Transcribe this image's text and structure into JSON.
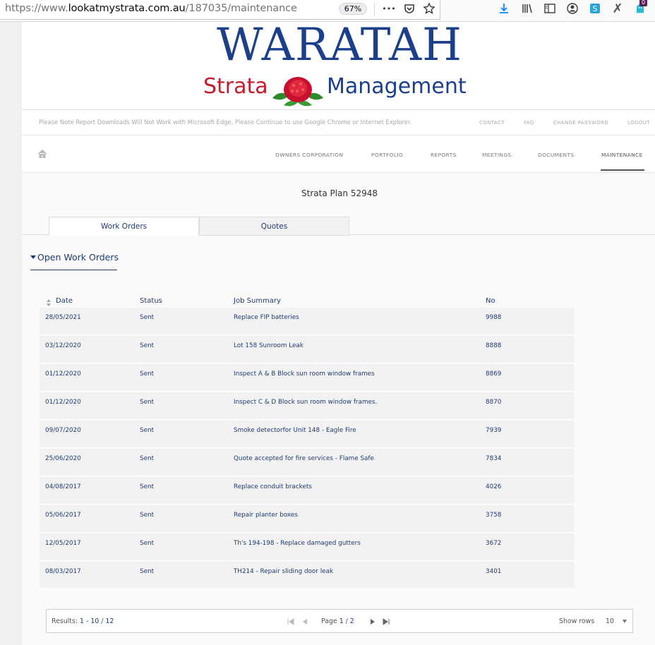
{
  "browser": {
    "url_prefix": "https://www.",
    "url_host": "lookatmystrata.com.au",
    "url_path": "/187035/maintenance",
    "zoom": "67%",
    "more_label": "•••",
    "notification_count": "0"
  },
  "logo": {
    "top": "WARATAH",
    "left": "Strata",
    "right": "Management"
  },
  "topbar": {
    "notice": "Please Note Report Downloads Will Not Work with Microsoft Edge, Please Continue to use Google Chrome or Internet Explorer.",
    "links": [
      "CONTACT",
      "FAQ",
      "CHANGE PASSWORD",
      "LOGOUT"
    ]
  },
  "nav": {
    "items": [
      "OWNERS CORPORATION",
      "PORTFOLIO",
      "REPORTS",
      "MEETINGS",
      "DOCUMENTS",
      "MAINTENANCE"
    ],
    "active": "MAINTENANCE"
  },
  "page": {
    "plan_title": "Strata Plan 52948",
    "tabs": [
      "Work Orders",
      "Quotes"
    ],
    "section_title": "Open Work Orders"
  },
  "table": {
    "headers": [
      "Date",
      "Status",
      "Job Summary",
      "No"
    ],
    "rows": [
      [
        "28/05/2021",
        "Sent",
        "Replace FIP batteries",
        "9988"
      ],
      [
        "03/12/2020",
        "Sent",
        "Lot 158 Sunroom Leak",
        "8888"
      ],
      [
        "01/12/2020",
        "Sent",
        "Inspect A & B Block sun room window frames",
        "8869"
      ],
      [
        "01/12/2020",
        "Sent",
        "Inspect C & D Block sun room window frames.",
        "8870"
      ],
      [
        "09/07/2020",
        "Sent",
        "Smoke detectorfor Unit 148 - Eagle Fire",
        "7939"
      ],
      [
        "25/06/2020",
        "Sent",
        "Quote accepted for fire services - Flame Safe",
        "7834"
      ],
      [
        "04/08/2017",
        "Sent",
        "Replace conduit brackets",
        "4026"
      ],
      [
        "05/06/2017",
        "Sent",
        "Repair planter boxes",
        "3758"
      ],
      [
        "12/05/2017",
        "Sent",
        "Th's 194-198 - Replace damaged gutters",
        "3672"
      ],
      [
        "08/03/2017",
        "Sent",
        "TH214 - Repair sliding door leak",
        "3401"
      ]
    ]
  },
  "pager": {
    "results_label": "Results:",
    "results_range": "1 - 10",
    "results_sep": "/",
    "results_total": "12",
    "page_label": "Page",
    "page_current": "1",
    "page_sep": "/",
    "page_total": "2",
    "show_rows_label": "Show rows",
    "show_rows_value": "10"
  }
}
